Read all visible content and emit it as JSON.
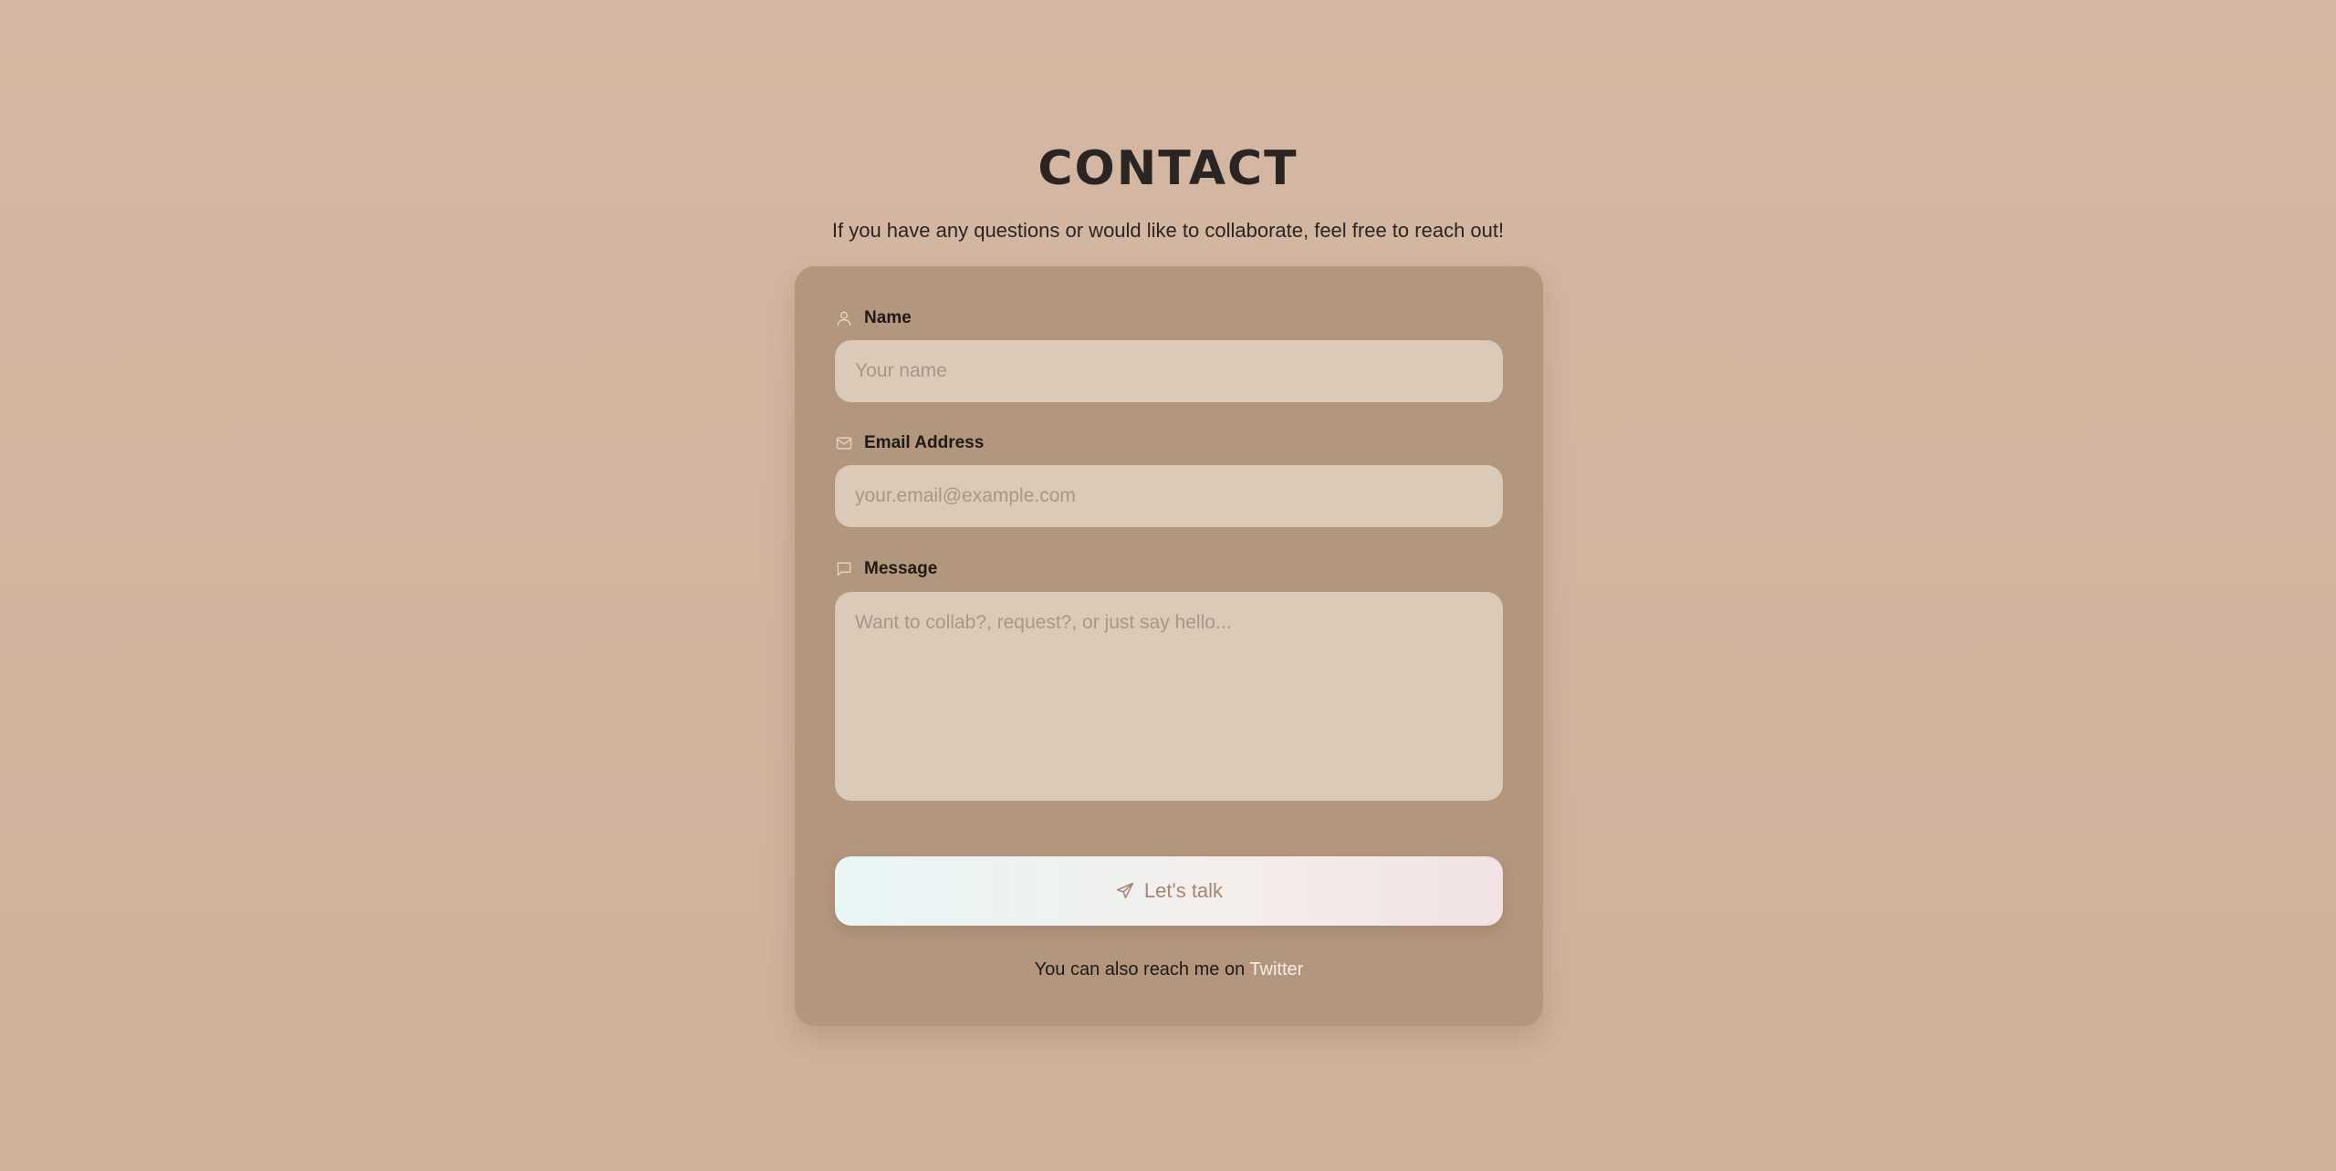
{
  "header": {
    "title": "CONTACT",
    "subtitle": "If you have any questions or would like to collaborate, feel free to reach out!"
  },
  "form": {
    "name": {
      "label": "Name",
      "icon": "user-icon",
      "placeholder": "Your name",
      "value": ""
    },
    "email": {
      "label": "Email Address",
      "icon": "mail-icon",
      "placeholder": "your.email@example.com",
      "value": ""
    },
    "message": {
      "label": "Message",
      "icon": "message-icon",
      "placeholder": "Want to collab?, request?, or just say hello...",
      "value": ""
    },
    "submit": {
      "label": "Let's talk",
      "icon": "send-icon"
    }
  },
  "footer": {
    "prefix": "You can also reach me on ",
    "link_label": "Twitter"
  },
  "colors": {
    "background": "#d4b8a3",
    "card": "#b3967e",
    "input": "#dccab9",
    "link": "#f5ece4"
  }
}
